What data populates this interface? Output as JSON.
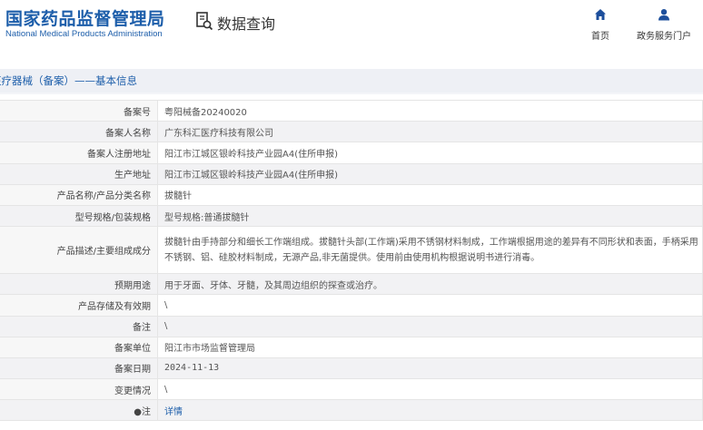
{
  "header": {
    "title_cn": "国家药品监督管理局",
    "title_en": "National Medical Products Administration",
    "query_title": "数据查询",
    "nav": [
      {
        "label": "首页",
        "icon": "home-icon"
      },
      {
        "label": "政务服务门户",
        "icon": "user-icon"
      }
    ]
  },
  "breadcrumb": "医疗器械（备案）——基本信息",
  "rows": [
    {
      "label": "备案号",
      "value": "粤阳械备20240020"
    },
    {
      "label": "备案人名称",
      "value": "广东科汇医疗科技有限公司"
    },
    {
      "label": "备案人注册地址",
      "value": "阳江市江城区银岭科技产业园A4(住所申报)"
    },
    {
      "label": "生产地址",
      "value": "阳江市江城区银岭科技产业园A4(住所申报)"
    },
    {
      "label": "产品名称/产品分类名称",
      "value": "拔髓针"
    },
    {
      "label": "型号规格/包装规格",
      "value": "型号规格:普通拔髓针"
    },
    {
      "label": "产品描述/主要组成成分",
      "value": "拔髓针由手持部分和细长工作端组成。拔髓针头部(工作端)采用不锈钢材料制成，工作端根据用途的差异有不同形状和表面，手柄采用不锈钢、铝、硅胶材料制成，无源产品,非无菌提供。使用前由使用机构根据说明书进行消毒。"
    },
    {
      "label": "预期用途",
      "value": "用于牙面、牙体、牙髓，及其周边组织的探查或治疗。"
    },
    {
      "label": "产品存储及有效期",
      "value": "\\"
    },
    {
      "label": "备注",
      "value": "\\"
    },
    {
      "label": "备案单位",
      "value": "阳江市市场监督管理局"
    },
    {
      "label": "备案日期",
      "value": "2024-11-13"
    },
    {
      "label": "变更情况",
      "value": "\\"
    },
    {
      "label": "●注",
      "value": "详情"
    }
  ]
}
